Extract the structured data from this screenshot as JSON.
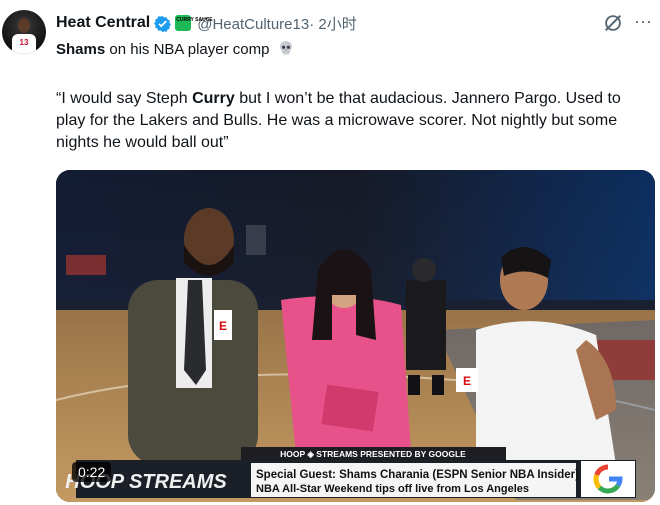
{
  "tweet": {
    "author_name": "Heat Central",
    "handle": "@HeatCulture13",
    "time": "· 2小时",
    "line1_bold": "Shams",
    "line1_rest": " on his NBA player comp",
    "quote_part1": "“I would say Steph ",
    "quote_bold": "Curry",
    "quote_part2": " but I won’t be that audacious. Jannero Pargo. Used to play for the Lakers and Bulls. He was a microwave scorer. Not nightly but some nights he would ball out”",
    "affiliate_badge_text": "CURRY SAUCE",
    "avatar_jersey_number": "13"
  },
  "video": {
    "timestamp": "0:22",
    "banner_top": "HOOP ◈ STREAMS PRESENTED BY GOOGLE",
    "show_logo": "HOOP STREAMS",
    "guest_line": "Special Guest: Shams Charania (ESPN Senior NBA Insider)",
    "ticker_line": "NBA All-Star Weekend tips off live from Los Angeles",
    "mic_logo": "E"
  },
  "icons": {
    "verified": "verified-badge-icon",
    "grok": "grok-icon",
    "more": "more-options-icon",
    "skull": "skull-emoji-icon"
  },
  "colors": {
    "verified_blue": "#1d9bf0",
    "handle_gray": "#536471",
    "espn_red": "#d50a0a",
    "dress_pink": "#e8528a"
  }
}
